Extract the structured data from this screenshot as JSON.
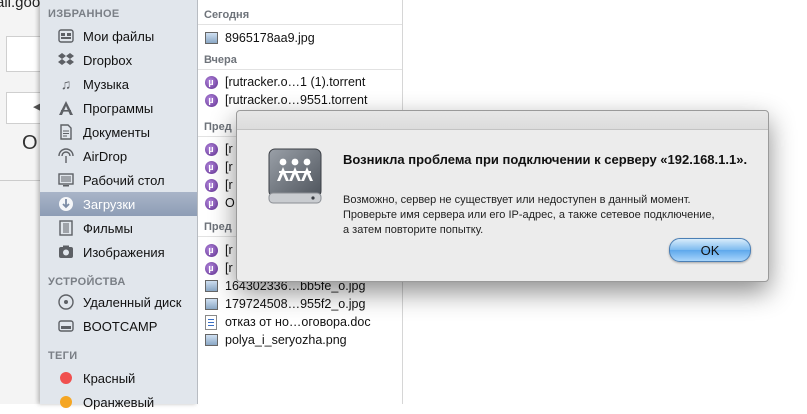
{
  "background_window": {
    "url_fragment": "ail.goo"
  },
  "sidebar": {
    "favorites_header": "ИЗБРАННОЕ",
    "favorites": [
      {
        "label": "Мои файлы",
        "icon": "all-files-icon"
      },
      {
        "label": "Dropbox",
        "icon": "dropbox-icon"
      },
      {
        "label": "Музыка",
        "icon": "music-icon"
      },
      {
        "label": "Программы",
        "icon": "applications-icon"
      },
      {
        "label": "Документы",
        "icon": "documents-icon"
      },
      {
        "label": "AirDrop",
        "icon": "airdrop-icon"
      },
      {
        "label": "Рабочий стол",
        "icon": "desktop-icon"
      },
      {
        "label": "Загрузки",
        "icon": "downloads-icon",
        "selected": true
      },
      {
        "label": "Фильмы",
        "icon": "movies-icon"
      },
      {
        "label": "Изображения",
        "icon": "pictures-icon"
      }
    ],
    "devices_header": "УСТРОЙСТВА",
    "devices": [
      {
        "label": "Удаленный диск",
        "icon": "remote-disc-icon"
      },
      {
        "label": "BOOTCAMP",
        "icon": "drive-icon"
      }
    ],
    "tags_header": "ТЕГИ",
    "tags": [
      {
        "label": "Красный",
        "color": "#f0504f"
      },
      {
        "label": "Оранжевый",
        "color": "#f5a623"
      }
    ]
  },
  "file_list": {
    "today_header": "Сегодня",
    "today": [
      {
        "name": "8965178aa9.jpg",
        "type": "image"
      }
    ],
    "yesterday_header": "Вчера",
    "yesterday": [
      {
        "name": "[rutracker.o…1 (1).torrent",
        "type": "torrent"
      },
      {
        "name": "[rutracker.o…9551.torrent",
        "type": "torrent"
      }
    ],
    "prev1_header": "Пред",
    "prev1": [
      {
        "name": "[r",
        "type": "torrent"
      },
      {
        "name": "[r",
        "type": "torrent"
      },
      {
        "name": "[r",
        "type": "torrent"
      },
      {
        "name": "O",
        "type": "torrent"
      }
    ],
    "prev2_header": "Пред",
    "prev2": [
      {
        "name": "[r",
        "type": "torrent"
      },
      {
        "name": "[r",
        "type": "torrent"
      },
      {
        "name": "164302336…bb5fe_o.jpg",
        "type": "image"
      },
      {
        "name": "179724508…955f2_o.jpg",
        "type": "image"
      },
      {
        "name": "отказ от но…оговора.doc",
        "type": "doc"
      },
      {
        "name": "polya_i_seryozha.png",
        "type": "image"
      }
    ]
  },
  "dialog": {
    "title": "Возникла проблема при подключении к серверу «192.168.1.1».",
    "message_line1": "Возможно, сервер не существует или недоступен в данный момент.",
    "message_line2": "Проверьте имя сервера или его IP-адрес, а также сетевое подключение,",
    "message_line3": "а затем повторите попытку.",
    "ok_label": "OK",
    "icon": "network-server-icon"
  }
}
